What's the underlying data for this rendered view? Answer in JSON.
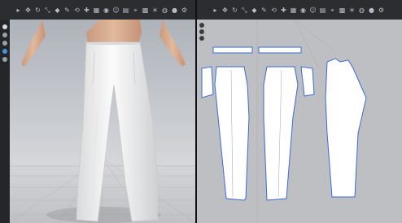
{
  "window": {
    "left_title": "",
    "right_title": ""
  },
  "toolbar_3d": {
    "icons": [
      "select-icon",
      "move-icon",
      "rotate-icon",
      "scale-icon",
      "pin-icon",
      "brush-icon",
      "fold-icon",
      "tack-icon",
      "grid-icon",
      "camera-icon",
      "avatar-icon",
      "display-icon",
      "measure-icon",
      "texture-icon",
      "light-icon",
      "render-icon",
      "record-icon",
      "settings-icon"
    ]
  },
  "toolbar_2d": {
    "icons": [
      "transform-icon",
      "edit-point-icon",
      "polygon-icon",
      "rectangle-icon",
      "circle-icon",
      "dart-icon",
      "internal-line-icon",
      "seam-icon",
      "fold-icon",
      "trace-icon",
      "grade-icon",
      "mirror-icon",
      "notch-icon",
      "button-icon",
      "topstitch-icon",
      "pleat-icon",
      "zoom-icon",
      "settings-icon"
    ]
  },
  "colors": {
    "pattern_outline": "#3b6ad6",
    "pattern_fill": "#ffffff",
    "background_2d": "#bdbfc2",
    "viewport_top": "#aeb3ba"
  }
}
